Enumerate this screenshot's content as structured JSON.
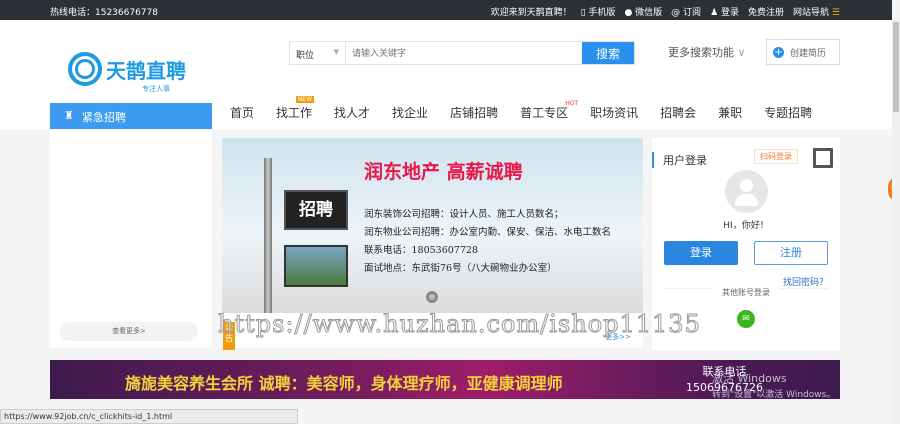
{
  "topbar": {
    "hotline": "热线电话：15236676778",
    "welcome": "欢迎来到天鹊直聘！",
    "mobile": "手机版",
    "wechat": "微信版",
    "subscribe": "订阅",
    "login": "登录",
    "register": "免费注册",
    "sitenav": "网站导航"
  },
  "logo": {
    "name": "天鹊直聘",
    "slogan": "专注人事"
  },
  "search": {
    "type": "职位",
    "placeholder": "请输入关键字",
    "button": "搜索",
    "more": "更多搜索功能",
    "create_resume": "创建简历"
  },
  "urgent": "紧急招聘",
  "nav": [
    {
      "label": "首页"
    },
    {
      "label": "找工作",
      "badge": "NEW"
    },
    {
      "label": "找人才"
    },
    {
      "label": "找企业"
    },
    {
      "label": "店铺招聘"
    },
    {
      "label": "普工专区",
      "badge": "HOT"
    },
    {
      "label": "职场资讯"
    },
    {
      "label": "招聘会"
    },
    {
      "label": "兼职"
    },
    {
      "label": "专题招聘"
    }
  ],
  "left": {
    "see_more": "查看更多>"
  },
  "banner": {
    "title": "润东地产 高薪诚聘",
    "sign": "招聘",
    "lines": [
      "润东装饰公司招聘：设计人员、施工人员数名；",
      "润东物业公司招聘：办公室内勤、保安、保洁、水电工数名",
      "联系电话：18053607728",
      "面试地点：东武街76号（八大碗物业办公室）"
    ]
  },
  "news": {
    "tag": "公告",
    "more": "更多>>"
  },
  "login": {
    "title": "用户登录",
    "scan": "扫码登录",
    "greeting": "HI，你好！",
    "login": "登录",
    "register": "注册",
    "forgot": "找回密码？",
    "other": "其他账号登录"
  },
  "ad": {
    "text": "旖旎美容养生会所 诚聘：美容师，身体理疗师，亚健康调理师",
    "phone_label": "联系电话",
    "phone": "15069676726"
  },
  "watermark": "https://www.huzhan.com/ishop11135",
  "windows": {
    "line1": "激活 Windows",
    "line2": "转到\"设置\"以激活 Windows。"
  },
  "statusbar": "https://www.92job.cn/c_clickhits-id_1.html",
  "float": "82"
}
